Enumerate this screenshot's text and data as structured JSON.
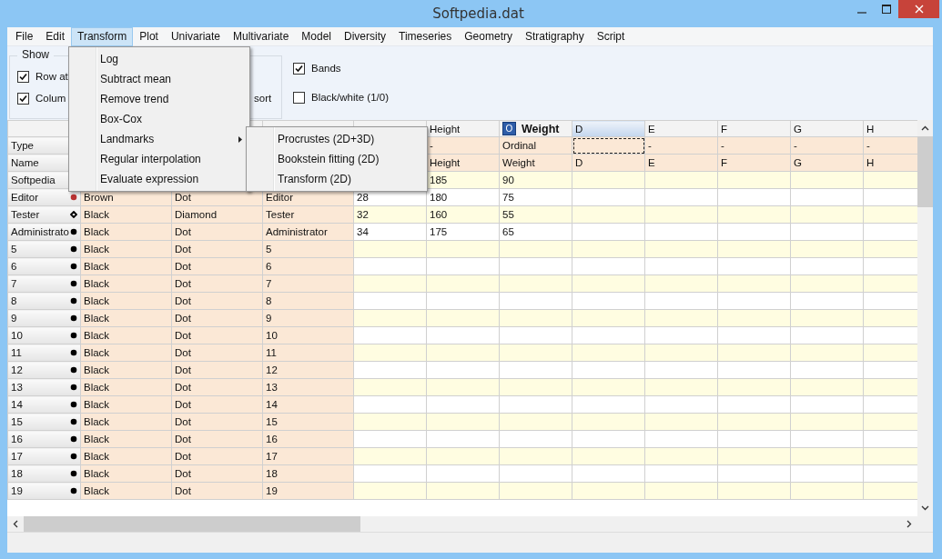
{
  "window": {
    "title": "Softpedia.dat"
  },
  "menu_bar": [
    {
      "label": "File",
      "selected": false
    },
    {
      "label": "Edit",
      "selected": false
    },
    {
      "label": "Transform",
      "selected": true
    },
    {
      "label": "Plot",
      "selected": false
    },
    {
      "label": "Univariate",
      "selected": false
    },
    {
      "label": "Multivariate",
      "selected": false
    },
    {
      "label": "Model",
      "selected": false
    },
    {
      "label": "Diversity",
      "selected": false
    },
    {
      "label": "Timeseries",
      "selected": false
    },
    {
      "label": "Geometry",
      "selected": false
    },
    {
      "label": "Stratigraphy",
      "selected": false
    },
    {
      "label": "Script",
      "selected": false
    }
  ],
  "options": {
    "show_group": {
      "title": "Show",
      "items": [
        {
          "label": "Row at",
          "checked": true
        },
        {
          "label": "Colum",
          "checked": true
        }
      ],
      "partial_label": "sort"
    },
    "items": [
      {
        "label": "Bands",
        "checked": true
      },
      {
        "label": "Black/white (1/0)",
        "checked": false
      }
    ]
  },
  "transform_menu": [
    {
      "label": "Log",
      "submenu": false
    },
    {
      "label": "Subtract mean",
      "submenu": false
    },
    {
      "label": "Remove trend",
      "submenu": false
    },
    {
      "label": "Box-Cox",
      "submenu": false
    },
    {
      "label": "Landmarks",
      "submenu": true
    },
    {
      "label": "Regular interpolation",
      "submenu": false
    },
    {
      "label": "Evaluate expression",
      "submenu": false
    }
  ],
  "landmarks_submenu": [
    "Procrustes (2D+3D)",
    "Bookstein fitting (2D)",
    "Transform (2D)"
  ],
  "table": {
    "columns": [
      {},
      {},
      {},
      {},
      {
        "label": "Height",
        "selected": false
      },
      {
        "label": "Weight",
        "badge": "O",
        "selected": false
      },
      {
        "label": "D",
        "selected": true
      },
      {
        "label": "E",
        "selected": false
      },
      {
        "label": "F",
        "selected": false
      },
      {
        "label": "G",
        "selected": false
      },
      {
        "label": "H",
        "selected": false
      }
    ],
    "rows": [
      {
        "kind": "attribute",
        "header": "Type",
        "cells": [
          null,
          null,
          null,
          null,
          "-",
          "Ordinal",
          {
            "focused": true
          },
          "-",
          "-",
          "-",
          "-"
        ]
      },
      {
        "kind": "attribute",
        "header": "Name",
        "cells": [
          null,
          null,
          null,
          null,
          "Height",
          "Weight",
          "D",
          "E",
          "F",
          "G",
          "H"
        ]
      },
      {
        "kind": "data",
        "header": "Softpedia",
        "cells": [
          null,
          null,
          null,
          null,
          "185",
          "90",
          null,
          null,
          null,
          null,
          null
        ]
      },
      {
        "kind": "data",
        "header": "Editor",
        "marker": {
          "kind": "dot",
          "color": "#b83232"
        },
        "cells": [
          "Brown",
          "Dot",
          "Editor",
          "28",
          "180",
          "75",
          null,
          null,
          null,
          null,
          null
        ]
      },
      {
        "kind": "data",
        "header": "Tester",
        "marker": {
          "kind": "diamond",
          "color": "#000000"
        },
        "cells": [
          "Black",
          "Diamond",
          "Tester",
          "32",
          "160",
          "55",
          null,
          null,
          null,
          null,
          null
        ]
      },
      {
        "kind": "data",
        "header": "Administrato",
        "marker": {
          "kind": "dot",
          "color": "#000000"
        },
        "cells": [
          "Black",
          "Dot",
          "Administrator",
          "34",
          "175",
          "65",
          null,
          null,
          null,
          null,
          null
        ]
      },
      {
        "kind": "data",
        "header": "5",
        "marker": {
          "kind": "dot",
          "color": "#000000"
        },
        "cells": [
          "Black",
          "Dot",
          "5",
          null,
          null,
          null,
          null,
          null,
          null,
          null,
          null
        ]
      },
      {
        "kind": "data",
        "header": "6",
        "marker": {
          "kind": "dot",
          "color": "#000000"
        },
        "cells": [
          "Black",
          "Dot",
          "6",
          null,
          null,
          null,
          null,
          null,
          null,
          null,
          null
        ]
      },
      {
        "kind": "data",
        "header": "7",
        "marker": {
          "kind": "dot",
          "color": "#000000"
        },
        "cells": [
          "Black",
          "Dot",
          "7",
          null,
          null,
          null,
          null,
          null,
          null,
          null,
          null
        ]
      },
      {
        "kind": "data",
        "header": "8",
        "marker": {
          "kind": "dot",
          "color": "#000000"
        },
        "cells": [
          "Black",
          "Dot",
          "8",
          null,
          null,
          null,
          null,
          null,
          null,
          null,
          null
        ]
      },
      {
        "kind": "data",
        "header": "9",
        "marker": {
          "kind": "dot",
          "color": "#000000"
        },
        "cells": [
          "Black",
          "Dot",
          "9",
          null,
          null,
          null,
          null,
          null,
          null,
          null,
          null
        ]
      },
      {
        "kind": "data",
        "header": "10",
        "marker": {
          "kind": "dot",
          "color": "#000000"
        },
        "cells": [
          "Black",
          "Dot",
          "10",
          null,
          null,
          null,
          null,
          null,
          null,
          null,
          null
        ]
      },
      {
        "kind": "data",
        "header": "11",
        "marker": {
          "kind": "dot",
          "color": "#000000"
        },
        "cells": [
          "Black",
          "Dot",
          "11",
          null,
          null,
          null,
          null,
          null,
          null,
          null,
          null
        ]
      },
      {
        "kind": "data",
        "header": "12",
        "marker": {
          "kind": "dot",
          "color": "#000000"
        },
        "cells": [
          "Black",
          "Dot",
          "12",
          null,
          null,
          null,
          null,
          null,
          null,
          null,
          null
        ]
      },
      {
        "kind": "data",
        "header": "13",
        "marker": {
          "kind": "dot",
          "color": "#000000"
        },
        "cells": [
          "Black",
          "Dot",
          "13",
          null,
          null,
          null,
          null,
          null,
          null,
          null,
          null
        ]
      },
      {
        "kind": "data",
        "header": "14",
        "marker": {
          "kind": "dot",
          "color": "#000000"
        },
        "cells": [
          "Black",
          "Dot",
          "14",
          null,
          null,
          null,
          null,
          null,
          null,
          null,
          null
        ]
      },
      {
        "kind": "data",
        "header": "15",
        "marker": {
          "kind": "dot",
          "color": "#000000"
        },
        "cells": [
          "Black",
          "Dot",
          "15",
          null,
          null,
          null,
          null,
          null,
          null,
          null,
          null
        ]
      },
      {
        "kind": "data",
        "header": "16",
        "marker": {
          "kind": "dot",
          "color": "#000000"
        },
        "cells": [
          "Black",
          "Dot",
          "16",
          null,
          null,
          null,
          null,
          null,
          null,
          null,
          null
        ]
      },
      {
        "kind": "data",
        "header": "17",
        "marker": {
          "kind": "dot",
          "color": "#000000"
        },
        "cells": [
          "Black",
          "Dot",
          "17",
          null,
          null,
          null,
          null,
          null,
          null,
          null,
          null
        ]
      },
      {
        "kind": "data",
        "header": "18",
        "marker": {
          "kind": "dot",
          "color": "#000000"
        },
        "cells": [
          "Black",
          "Dot",
          "18",
          null,
          null,
          null,
          null,
          null,
          null,
          null,
          null
        ]
      },
      {
        "kind": "data",
        "header": "19",
        "marker": {
          "kind": "dot",
          "color": "#000000"
        },
        "cells": [
          "Black",
          "Dot",
          "19",
          null,
          null,
          null,
          null,
          null,
          null,
          null,
          null
        ]
      }
    ]
  }
}
